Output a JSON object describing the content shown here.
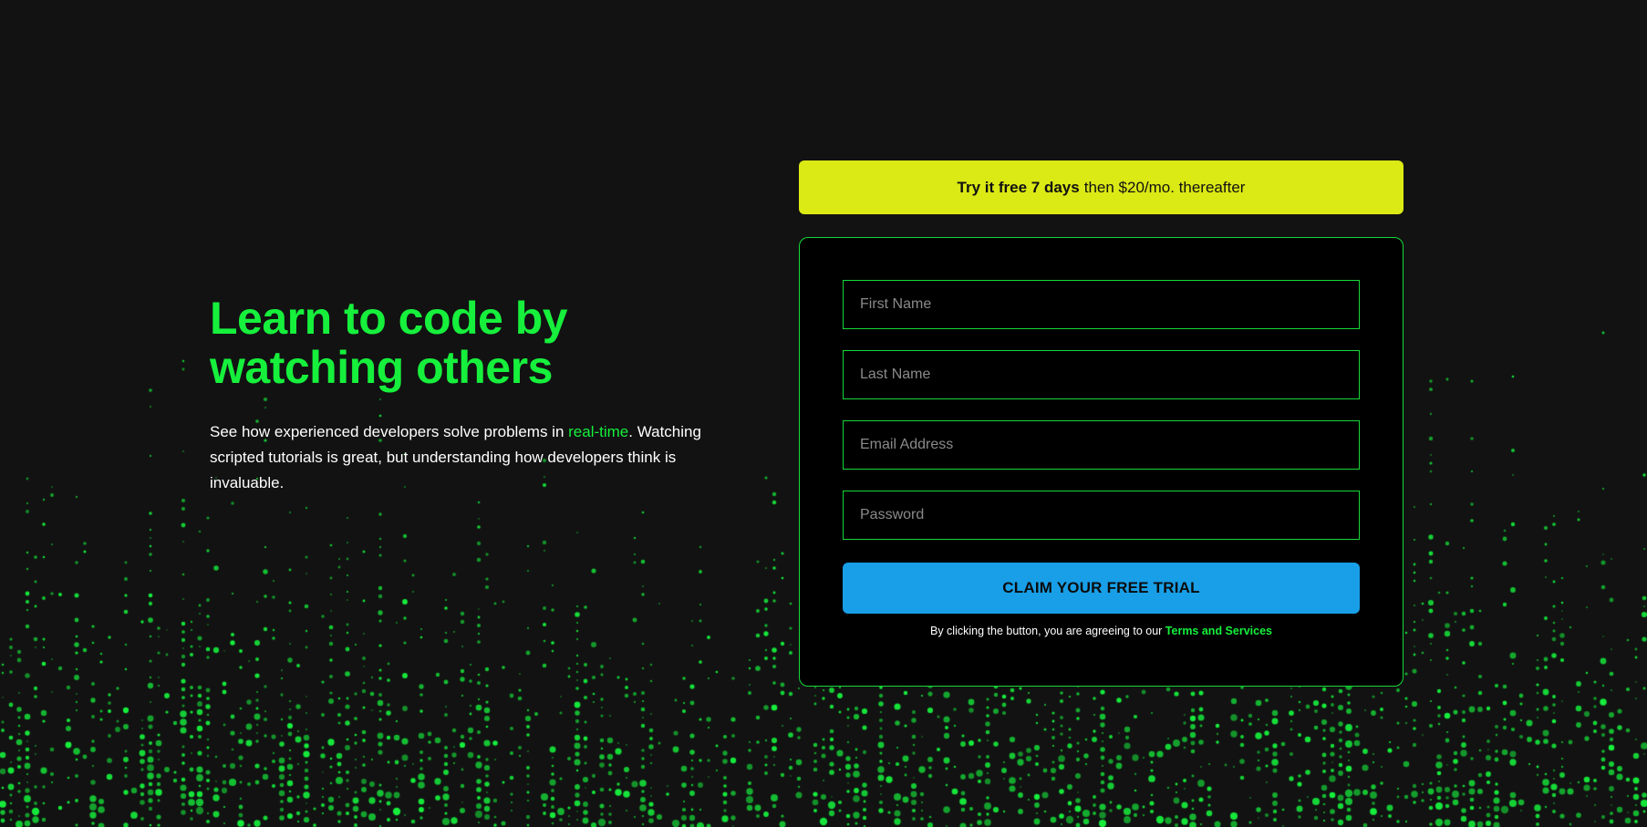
{
  "hero": {
    "title": "Learn to code by watching others",
    "desc_before": "See how experienced developers solve problems in ",
    "desc_accent": "real-time",
    "desc_after": ". Watching scripted tutorials is great, but understanding how developers think is invaluable."
  },
  "promo": {
    "bold": "Try it free 7 days",
    "rest": "then $20/mo. thereafter"
  },
  "form": {
    "first_name_placeholder": "First Name",
    "last_name_placeholder": "Last Name",
    "email_placeholder": "Email Address",
    "password_placeholder": "Password",
    "submit_label": "CLAIM YOUR FREE TRIAL",
    "terms_text": "By clicking the button, you are agreeing to our ",
    "terms_link": "Terms and Services"
  },
  "colors": {
    "background": "#121212",
    "accent_green": "#16f03c",
    "promo_yellow": "#dbe915",
    "button_blue": "#189fe8"
  }
}
